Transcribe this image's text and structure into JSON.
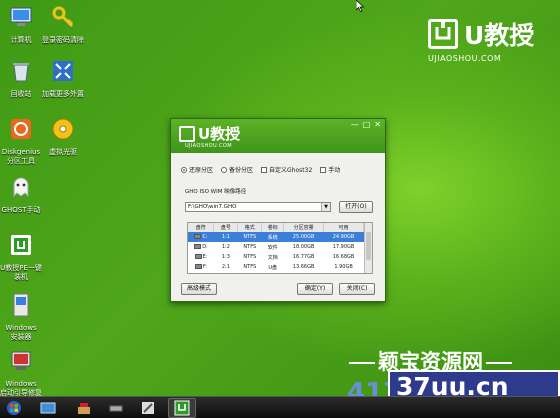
{
  "desktop_icons": [
    {
      "label": "计算机"
    },
    {
      "label": "登录密码清除"
    },
    {
      "label": "回收站"
    },
    {
      "label": "加载更多外置"
    },
    {
      "label": "Diskgenius\n分区工具"
    },
    {
      "label": "虚拟光驱"
    },
    {
      "label": "GHOST手动"
    },
    {
      "label": "U教授PE一键\n装机"
    },
    {
      "label": "Windows\n安装器"
    },
    {
      "label": "Windows\n启动引导修复"
    }
  ],
  "brand": {
    "name": "U教授",
    "domain": "UJIAOSHOU.COM"
  },
  "dialog": {
    "logo": {
      "name": "U教授",
      "domain": "UJIAOSHOU.COM"
    },
    "window_buttons": [
      "—",
      "□",
      "✕"
    ],
    "options": [
      {
        "label": "还原分区",
        "type": "radio",
        "checked": true
      },
      {
        "label": "备份分区",
        "type": "radio",
        "checked": false
      },
      {
        "label": "自定义Ghost32",
        "type": "checkbox",
        "checked": false
      },
      {
        "label": "手动",
        "type": "checkbox",
        "checked": false
      }
    ],
    "path_label": "GHO ISO WIM 映像路径",
    "path_value": "F:\\GHO\\win7.GHO",
    "open_button": "打开(O)",
    "table": {
      "headers": [
        "盘符",
        "盘号",
        "格式",
        "卷标",
        "分区容量",
        "可用"
      ],
      "rows": [
        [
          "C:",
          "1:1",
          "NTFS",
          "系统",
          "25.00GB",
          "24.90GB"
        ],
        [
          "D:",
          "1:2",
          "NTFS",
          "软件",
          "18.00GB",
          "17.90GB"
        ],
        [
          "E:",
          "1:3",
          "NTFS",
          "文档",
          "16.77GB",
          "16.68GB"
        ],
        [
          "F:",
          "2:1",
          "NTFS",
          "U盘",
          "13.66GB",
          "1.90GB"
        ]
      ],
      "selected_row": 0
    },
    "advanced_button": "高级模式",
    "ok_button": "确定(Y)",
    "close_button": "关闭(C)"
  },
  "watermark": {
    "line1": "颖宝资源网",
    "number": "417",
    "site": "37uu.cn"
  }
}
